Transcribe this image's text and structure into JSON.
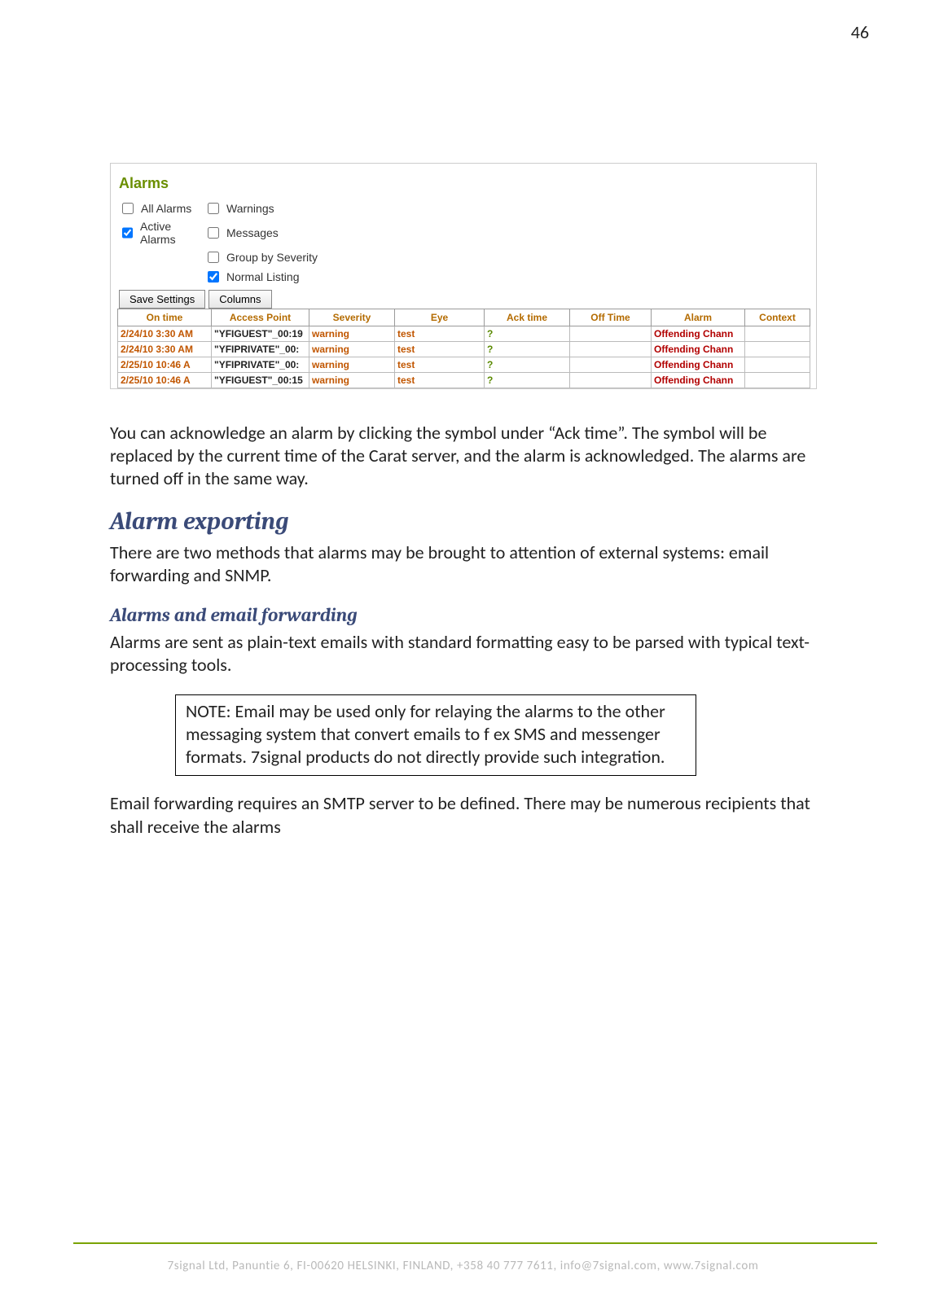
{
  "page_number": "46",
  "ui": {
    "title": "Alarms",
    "filters": {
      "all_alarms": "All Alarms",
      "active_alarms": "Active Alarms",
      "warnings": "Warnings",
      "messages": "Messages",
      "group_by_severity": "Group by Severity",
      "normal_listing": "Normal Listing"
    },
    "buttons": {
      "save_settings": "Save Settings",
      "columns": "Columns"
    },
    "table": {
      "headers": [
        "On time",
        "Access Point",
        "Severity",
        "Eye",
        "Ack time",
        "Off Time",
        "Alarm",
        "Context"
      ],
      "rows": [
        {
          "on": "2/24/10 3:30 AM",
          "ap": "\"YFIGUEST\"_00:19",
          "sev": "warning",
          "eye": "test",
          "ack": "?",
          "off": "",
          "alarm": "Offending Chann",
          "ctx": ""
        },
        {
          "on": "2/24/10 3:30 AM",
          "ap": "\"YFIPRIVATE\"_00:",
          "sev": "warning",
          "eye": "test",
          "ack": "?",
          "off": "",
          "alarm": "Offending Chann",
          "ctx": ""
        },
        {
          "on": "2/25/10 10:46 A",
          "ap": "\"YFIPRIVATE\"_00:",
          "sev": "warning",
          "eye": "test",
          "ack": "?",
          "off": "",
          "alarm": "Offending Chann",
          "ctx": ""
        },
        {
          "on": "2/25/10 10:46 A",
          "ap": "\"YFIGUEST\"_00:15",
          "sev": "warning",
          "eye": "test",
          "ack": "?",
          "off": "",
          "alarm": "Offending Chann",
          "ctx": ""
        }
      ]
    }
  },
  "prose": {
    "p1": "You can acknowledge an alarm by clicking the symbol under “Ack time”. The symbol will be replaced by the current time of the Carat server, and the alarm is acknowledged. The alarms are turned off in the same way.",
    "h2_alarm_exporting": "Alarm exporting",
    "p2": "There are two methods that alarms may be brought to attention of external systems: email forwarding and SNMP.",
    "h3_email": "Alarms and email forwarding",
    "p3": "Alarms are sent as plain-text emails with standard formatting easy to be parsed with typical text-processing tools.",
    "note": "NOTE: Email may be used only for relaying the alarms to the other messaging system that convert emails to f ex SMS and messenger formats. 7signal products do not directly provide such integration.",
    "p4": "Email forwarding requires an SMTP server to be defined. There may be numerous recipients that shall receive the alarms"
  },
  "footer": "7signal Ltd, Panuntie 6, FI-00620 HELSINKI, FINLAND, +358 40 777 7611, info@7signal.com, www.7signal.com"
}
